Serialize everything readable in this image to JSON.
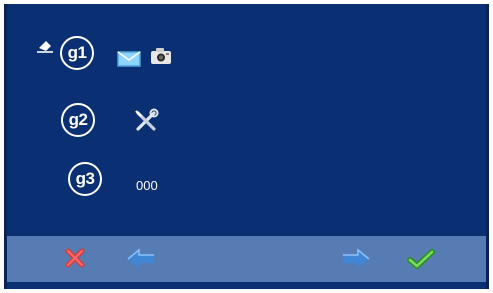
{
  "groups": [
    {
      "badge": "g1",
      "icons": [
        "eraser-icon",
        "envelope-icon",
        "camera-icon"
      ]
    },
    {
      "badge": "g2",
      "icons": [
        "tools-icon"
      ]
    },
    {
      "badge": "g3",
      "value": "000"
    }
  ],
  "toolbar": {
    "buttons": [
      "cancel-icon",
      "left-arrow-icon",
      "right-arrow-icon",
      "confirm-check-icon"
    ]
  },
  "colors": {
    "background": "#0b2f73",
    "toolbar": "#577cb4",
    "cancel": "#d93b3b",
    "arrow": "#3f86d6",
    "confirm": "#49b538"
  }
}
